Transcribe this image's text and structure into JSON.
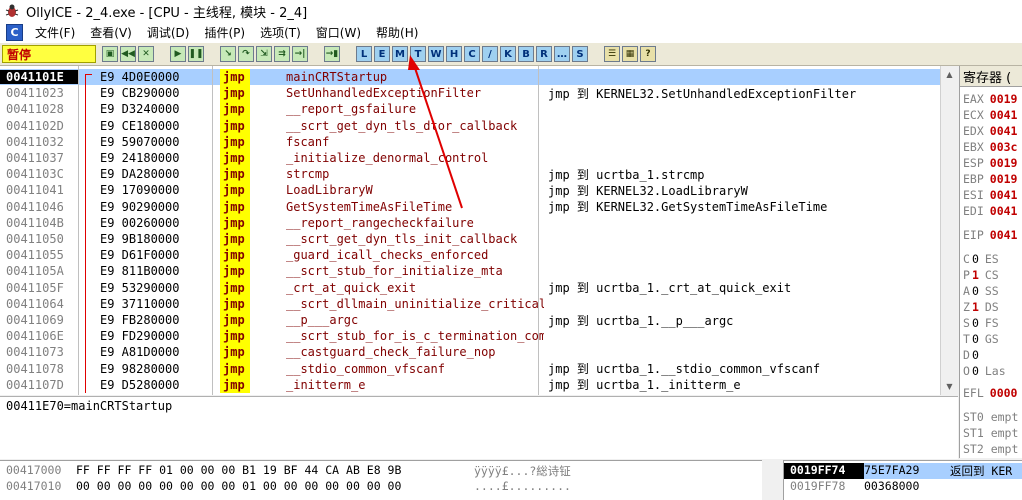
{
  "window": {
    "title": "OllyICE - 2_4.exe - [CPU - 主线程, 模块 - 2_4]"
  },
  "menu": [
    "文件(F)",
    "查看(V)",
    "调试(D)",
    "插件(P)",
    "选项(T)",
    "窗口(W)",
    "帮助(H)"
  ],
  "mdi_icon": "C",
  "toolbar": {
    "status": "暂停",
    "buttons": [
      {
        "icon": "open-icon",
        "label": "▣",
        "style": "g"
      },
      {
        "icon": "rewind-icon",
        "label": "◀◀",
        "style": "g"
      },
      {
        "icon": "close-icon",
        "label": "✕",
        "style": "g"
      },
      {
        "gap": true
      },
      {
        "icon": "run-icon",
        "label": "▶",
        "style": "g"
      },
      {
        "icon": "pause-icon",
        "label": "❚❚",
        "style": "g"
      },
      {
        "gap": true
      },
      {
        "icon": "step-into-icon",
        "label": "↘",
        "style": "g"
      },
      {
        "icon": "step-over-icon",
        "label": "↷",
        "style": "g"
      },
      {
        "icon": "trace-into-icon",
        "label": "⇲",
        "style": "g"
      },
      {
        "icon": "trace-over-icon",
        "label": "⇉",
        "style": "g"
      },
      {
        "icon": "execute-till-return-icon",
        "label": "→|",
        "style": "g"
      },
      {
        "gap": true
      },
      {
        "icon": "goto-icon",
        "label": "→▮",
        "style": "g"
      },
      {
        "gap": true
      },
      {
        "icon": "log-window-icon",
        "label": "L",
        "style": "b"
      },
      {
        "icon": "modules-window-icon",
        "label": "E",
        "style": "b"
      },
      {
        "icon": "memory-window-icon",
        "label": "M",
        "style": "b"
      },
      {
        "icon": "threads-window-icon",
        "label": "T",
        "style": "b"
      },
      {
        "icon": "windows-window-icon",
        "label": "W",
        "style": "b"
      },
      {
        "icon": "handles-window-icon",
        "label": "H",
        "style": "b"
      },
      {
        "icon": "cpu-window-icon",
        "label": "C",
        "style": "b"
      },
      {
        "icon": "patches-window-icon",
        "label": "/",
        "style": "b"
      },
      {
        "icon": "call-stack-icon",
        "label": "K",
        "style": "b"
      },
      {
        "icon": "breakpoints-window-icon",
        "label": "B",
        "style": "b"
      },
      {
        "icon": "references-window-icon",
        "label": "R",
        "style": "b"
      },
      {
        "icon": "run-trace-icon",
        "label": "…",
        "style": "b"
      },
      {
        "icon": "source-window-icon",
        "label": "S",
        "style": "b"
      },
      {
        "gap": true
      },
      {
        "icon": "options-list-icon",
        "label": "☰",
        "style": "y"
      },
      {
        "icon": "appearance-icon",
        "label": "▦",
        "style": "y"
      },
      {
        "icon": "help-icon",
        "label": "?",
        "style": "y"
      }
    ]
  },
  "disasm": {
    "rows": [
      {
        "addr": "0041101E",
        "bytes": "E9 4D0E0000",
        "mn": "jmp",
        "op": "mainCRTStartup",
        "cm": "",
        "sel": true
      },
      {
        "addr": "00411023",
        "bytes": "E9 CB290000",
        "mn": "jmp",
        "op": "SetUnhandledExceptionFilter",
        "cm": "jmp 到 KERNEL32.SetUnhandledExceptionFilter"
      },
      {
        "addr": "00411028",
        "bytes": "E9 D3240000",
        "mn": "jmp",
        "op": "__report_gsfailure",
        "cm": ""
      },
      {
        "addr": "0041102D",
        "bytes": "E9 CE180000",
        "mn": "jmp",
        "op": "__scrt_get_dyn_tls_dtor_callback",
        "cm": ""
      },
      {
        "addr": "00411032",
        "bytes": "E9 59070000",
        "mn": "jmp",
        "op": "fscanf",
        "cm": ""
      },
      {
        "addr": "00411037",
        "bytes": "E9 24180000",
        "mn": "jmp",
        "op": "_initialize_denormal_control",
        "cm": ""
      },
      {
        "addr": "0041103C",
        "bytes": "E9 DA280000",
        "mn": "jmp",
        "op": "strcmp",
        "cm": "jmp 到 ucrtba_1.strcmp"
      },
      {
        "addr": "00411041",
        "bytes": "E9 17090000",
        "mn": "jmp",
        "op": "LoadLibraryW",
        "cm": "jmp 到 KERNEL32.LoadLibraryW"
      },
      {
        "addr": "00411046",
        "bytes": "E9 90290000",
        "mn": "jmp",
        "op": "GetSystemTimeAsFileTime",
        "cm": "jmp 到 KERNEL32.GetSystemTimeAsFileTime"
      },
      {
        "addr": "0041104B",
        "bytes": "E9 00260000",
        "mn": "jmp",
        "op": "__report_rangecheckfailure",
        "cm": ""
      },
      {
        "addr": "00411050",
        "bytes": "E9 9B180000",
        "mn": "jmp",
        "op": "__scrt_get_dyn_tls_init_callback",
        "cm": ""
      },
      {
        "addr": "00411055",
        "bytes": "E9 D61F0000",
        "mn": "jmp",
        "op": "_guard_icall_checks_enforced",
        "cm": ""
      },
      {
        "addr": "0041105A",
        "bytes": "E9 811B0000",
        "mn": "jmp",
        "op": "__scrt_stub_for_initialize_mta",
        "cm": ""
      },
      {
        "addr": "0041105F",
        "bytes": "E9 53290000",
        "mn": "jmp",
        "op": "_crt_at_quick_exit",
        "cm": "jmp 到 ucrtba_1._crt_at_quick_exit"
      },
      {
        "addr": "00411064",
        "bytes": "E9 37110000",
        "mn": "jmp",
        "op": "__scrt_dllmain_uninitialize_critical",
        "cm": ""
      },
      {
        "addr": "00411069",
        "bytes": "E9 FB280000",
        "mn": "jmp",
        "op": "__p___argc",
        "cm": "jmp 到 ucrtba_1.__p___argc"
      },
      {
        "addr": "0041106E",
        "bytes": "E9 FD290000",
        "mn": "jmp",
        "op": "__scrt_stub_for_is_c_termination_complete",
        "cm": ""
      },
      {
        "addr": "00411073",
        "bytes": "E9 A81D0000",
        "mn": "jmp",
        "op": "__castguard_check_failure_nop",
        "cm": ""
      },
      {
        "addr": "00411078",
        "bytes": "E9 98280000",
        "mn": "jmp",
        "op": "__stdio_common_vfscanf",
        "cm": "jmp 到 ucrtba_1.__stdio_common_vfscanf"
      },
      {
        "addr": "0041107D",
        "bytes": "E9 D5280000",
        "mn": "jmp",
        "op": "_initterm_e",
        "cm": "jmp 到 ucrtba_1._initterm_e"
      }
    ]
  },
  "info": {
    "text": "00411E70=mainCRTStartup"
  },
  "registers": {
    "title": "寄存器 (",
    "gp": [
      {
        "name": "EAX",
        "val": "0019"
      },
      {
        "name": "ECX",
        "val": "0041"
      },
      {
        "name": "EDX",
        "val": "0041"
      },
      {
        "name": "EBX",
        "val": "003c"
      },
      {
        "name": "ESP",
        "val": "0019"
      },
      {
        "name": "EBP",
        "val": "0019"
      },
      {
        "name": "ESI",
        "val": "0041"
      },
      {
        "name": "EDI",
        "val": "0041"
      }
    ],
    "eip": {
      "name": "EIP",
      "val": "0041"
    },
    "flags": [
      {
        "name": "C",
        "val": "0",
        "seg": "ES",
        "hl": false
      },
      {
        "name": "P",
        "val": "1",
        "seg": "CS",
        "hl": true
      },
      {
        "name": "A",
        "val": "0",
        "seg": "SS",
        "hl": false
      },
      {
        "name": "Z",
        "val": "1",
        "seg": "DS",
        "hl": true
      },
      {
        "name": "S",
        "val": "0",
        "seg": "FS",
        "hl": false
      },
      {
        "name": "T",
        "val": "0",
        "seg": "GS",
        "hl": false
      },
      {
        "name": "D",
        "val": "0",
        "seg": "",
        "hl": false
      },
      {
        "name": "O",
        "val": "0",
        "seg": "Las",
        "hl": false
      }
    ],
    "efl": {
      "name": "EFL",
      "val": "0000"
    },
    "fpu": [
      "ST0 empt",
      "ST1 empt",
      "ST2 empt"
    ]
  },
  "dump": {
    "rows": [
      {
        "addr": "00417000",
        "hex": "FF FF FF FF 01 00 00 00 B1 19 BF 44 CA AB E8 9B",
        "asc": "ÿÿÿÿ£...?総诗钲"
      },
      {
        "addr": "00417010",
        "hex": "00 00 00 00 00 00 00 00 01 00 00 00 00 00 00 00",
        "asc": "....£........."
      }
    ]
  },
  "stack": {
    "rows": [
      {
        "addr": "0019FF74",
        "val": "75E7FA29",
        "cm": "返回到 KER",
        "sel": true
      },
      {
        "addr": "0019FF78",
        "val": "00368000",
        "cm": ""
      }
    ]
  },
  "colors": {
    "accent_red": "#c00000",
    "selection": "#a8cfff",
    "mnemonic_bg": "#ffff00",
    "annotation": "#e00000"
  }
}
